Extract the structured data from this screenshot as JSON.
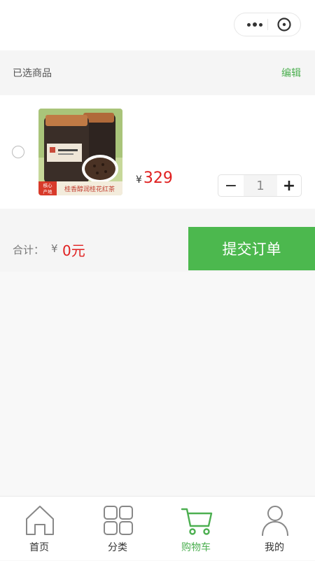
{
  "cart": {
    "selected_title": "已选商品",
    "edit_label": "编辑"
  },
  "item": {
    "image_caption_left": "核心产地",
    "image_caption_right": "桂香醇润桂花红茶",
    "currency": "¥",
    "price": "329",
    "quantity": "1",
    "minus": "−",
    "plus": "+"
  },
  "summary": {
    "total_label": "合计：",
    "currency": "¥",
    "total_value": "0元",
    "submit_label": "提交订单"
  },
  "tabbar": {
    "items": [
      {
        "label": "首页",
        "icon": "home-icon"
      },
      {
        "label": "分类",
        "icon": "grid-icon"
      },
      {
        "label": "购物车",
        "icon": "cart-icon"
      },
      {
        "label": "我的",
        "icon": "user-icon"
      }
    ],
    "active_index": 2,
    "accent_color": "#4caf50"
  },
  "colors": {
    "accent": "#4caf50",
    "submit_bg": "#4cb84e",
    "price": "#e02020"
  }
}
